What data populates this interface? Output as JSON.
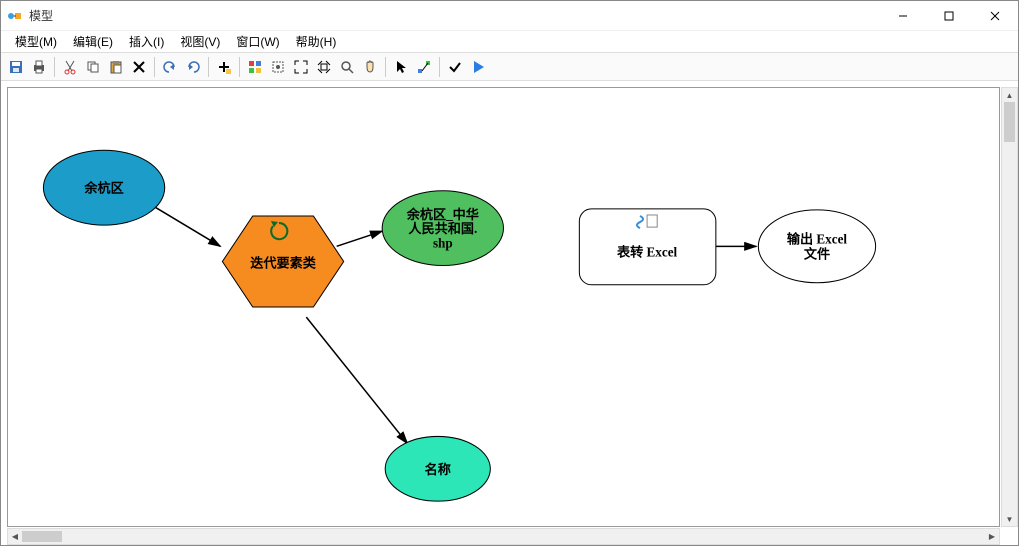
{
  "window": {
    "title": "模型"
  },
  "menu": {
    "model": "模型(M)",
    "edit": "编辑(E)",
    "insert": "插入(I)",
    "view": "视图(V)",
    "window": "窗口(W)",
    "help": "帮助(H)"
  },
  "nodes": {
    "input1": "余杭区",
    "tool1": "迭代要素类",
    "output1_line1": "余杭区_中华",
    "output1_line2": "人民共和国.",
    "output1_line3": "shp",
    "output2": "名称",
    "tool2": "表转 Excel",
    "output3_line1": "输出 Excel",
    "output3_line2": "文件"
  },
  "chart_data": {
    "type": "modelbuilder_diagram",
    "title": "模型",
    "nodes": [
      {
        "id": "n1",
        "type": "input_data",
        "shape": "ellipse",
        "color": "#1C9CC9",
        "label": "余杭区"
      },
      {
        "id": "n2",
        "type": "iterator_tool",
        "shape": "hexagon",
        "color": "#F68B1F",
        "label": "迭代要素类",
        "has_loop_icon": true
      },
      {
        "id": "n3",
        "type": "output_data",
        "shape": "ellipse",
        "color": "#4FBF60",
        "label": "余杭区_中华人民共和国.shp"
      },
      {
        "id": "n4",
        "type": "output_value",
        "shape": "ellipse",
        "color": "#2CE6B7",
        "label": "名称"
      },
      {
        "id": "n5",
        "type": "tool",
        "shape": "rounded_rect",
        "color": "#FFFFFF",
        "label": "表转 Excel",
        "not_ready": true
      },
      {
        "id": "n6",
        "type": "output_data",
        "shape": "ellipse",
        "color": "#FFFFFF",
        "label": "输出 Excel 文件",
        "not_ready": true
      }
    ],
    "edges": [
      {
        "from": "n1",
        "to": "n2"
      },
      {
        "from": "n2",
        "to": "n3"
      },
      {
        "from": "n2",
        "to": "n4"
      },
      {
        "from": "n5",
        "to": "n6"
      }
    ]
  }
}
